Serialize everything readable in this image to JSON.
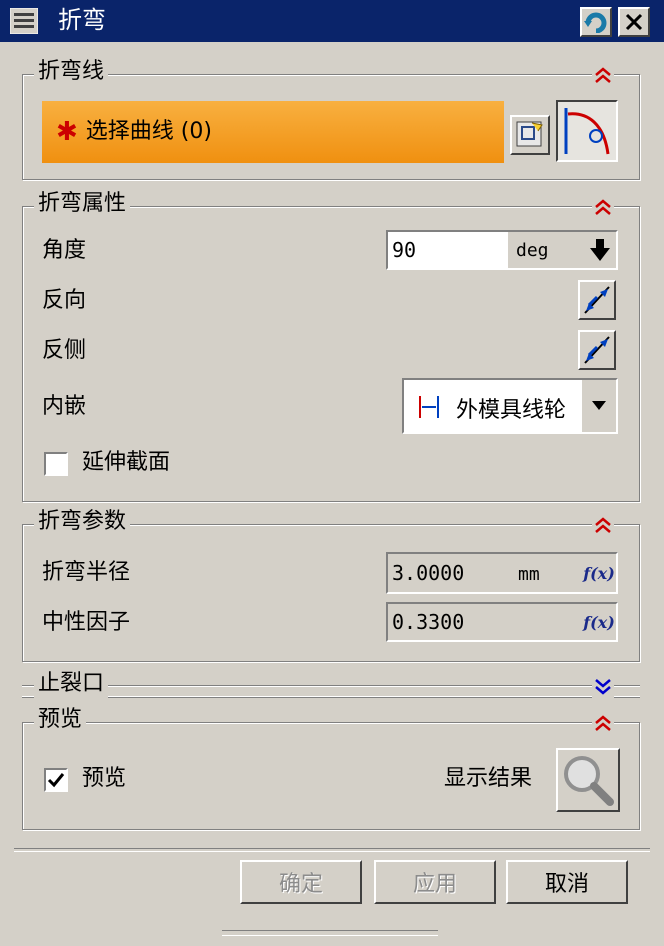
{
  "window": {
    "title": "折弯"
  },
  "bend_line": {
    "group_label": "折弯线",
    "select_curve_label": "选择曲线 (0)"
  },
  "bend_props": {
    "group_label": "折弯属性",
    "angle_label": "角度",
    "angle_value": "90",
    "angle_unit": "deg",
    "reverse_dir_label": "反向",
    "reverse_side_label": "反侧",
    "inset_label": "内嵌",
    "inset_value": "外模具线轮",
    "extend_section_label": "延伸截面"
  },
  "bend_params": {
    "group_label": "折弯参数",
    "radius_label": "折弯半径",
    "radius_value": "3.0000",
    "radius_unit": "mm",
    "neutral_label": "中性因子",
    "neutral_value": "0.3300",
    "fx_label": "f(x)"
  },
  "relief": {
    "group_label": "止裂口"
  },
  "preview": {
    "group_label": "预览",
    "preview_label": "预览",
    "show_result_label": "显示结果"
  },
  "buttons": {
    "ok": "确定",
    "apply": "应用",
    "cancel": "取消"
  },
  "colors": {
    "title_bg": "#0a246a",
    "selection_bg": "#f5a623",
    "collapse": "#cc0000",
    "expand": "#0000cc"
  }
}
